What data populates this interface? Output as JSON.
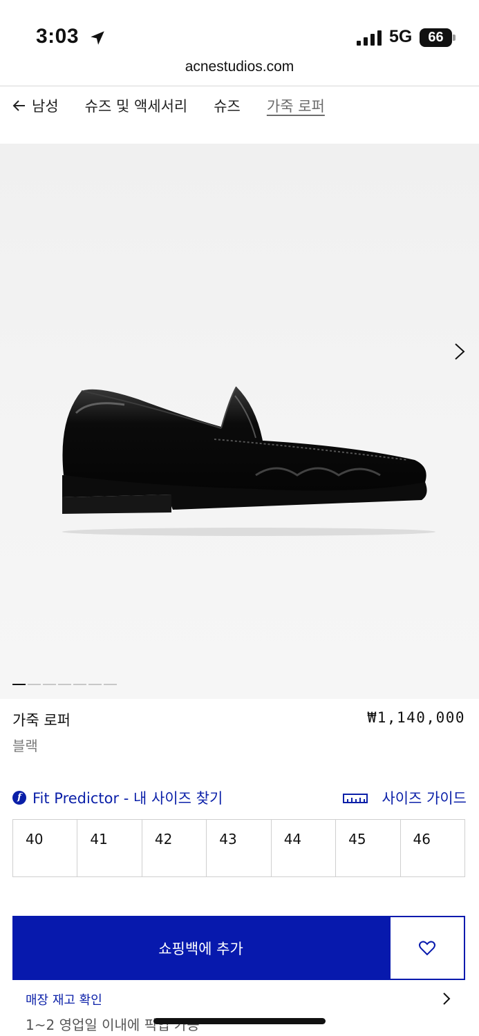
{
  "status_bar": {
    "time": "3:03",
    "network": "5G",
    "battery": "66",
    "icons": [
      "location-arrow-icon",
      "signal-bars-icon",
      "battery-icon"
    ]
  },
  "browser": {
    "url": "acnestudios.com"
  },
  "breadcrumb": {
    "items": [
      {
        "label": "남성"
      },
      {
        "label": "슈즈 및 액세서리"
      },
      {
        "label": "슈즈"
      },
      {
        "label": "가죽 로퍼"
      }
    ]
  },
  "gallery": {
    "image_alt": "black leather loafer",
    "page_count": 7,
    "active_index": 0
  },
  "product": {
    "name": "가죽 로퍼",
    "color": "블랙",
    "price": "₩1,140,000"
  },
  "fit": {
    "fit_predictor_label": "Fit Predictor - 내 사이즈 찾기",
    "fit_icon_glyph": "f",
    "size_guide_label": "사이즈 가이드"
  },
  "sizes": [
    "40",
    "41",
    "42",
    "43",
    "44",
    "45",
    "46"
  ],
  "actions": {
    "add_to_bag_label": "쇼핑백에 추가"
  },
  "stock": {
    "title": "매장 재고 확인",
    "subtitle": "1~2 영업일 이내에 픽업 가능"
  },
  "colors": {
    "accent": "#0719ad",
    "link": "#0a1fa8"
  }
}
